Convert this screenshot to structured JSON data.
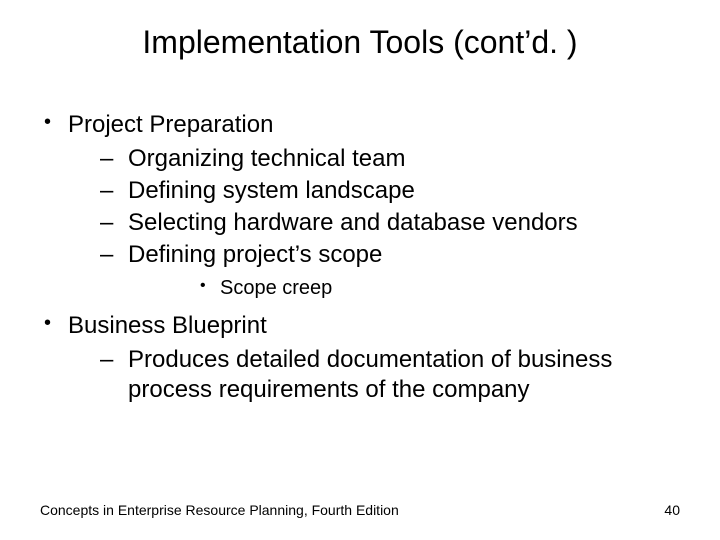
{
  "title": "Implementation Tools (cont’d. )",
  "bullets": {
    "project_preparation": {
      "label": "Project Preparation",
      "items": [
        "Organizing technical team",
        "Defining system landscape",
        "Selecting hardware and database vendors",
        "Defining project’s scope"
      ],
      "sub": "Scope creep"
    },
    "business_blueprint": {
      "label": "Business Blueprint",
      "items": [
        "Produces detailed documentation of business process requirements of the company"
      ]
    }
  },
  "footer": {
    "source": "Concepts in Enterprise Resource Planning, Fourth Edition",
    "page": "40"
  }
}
